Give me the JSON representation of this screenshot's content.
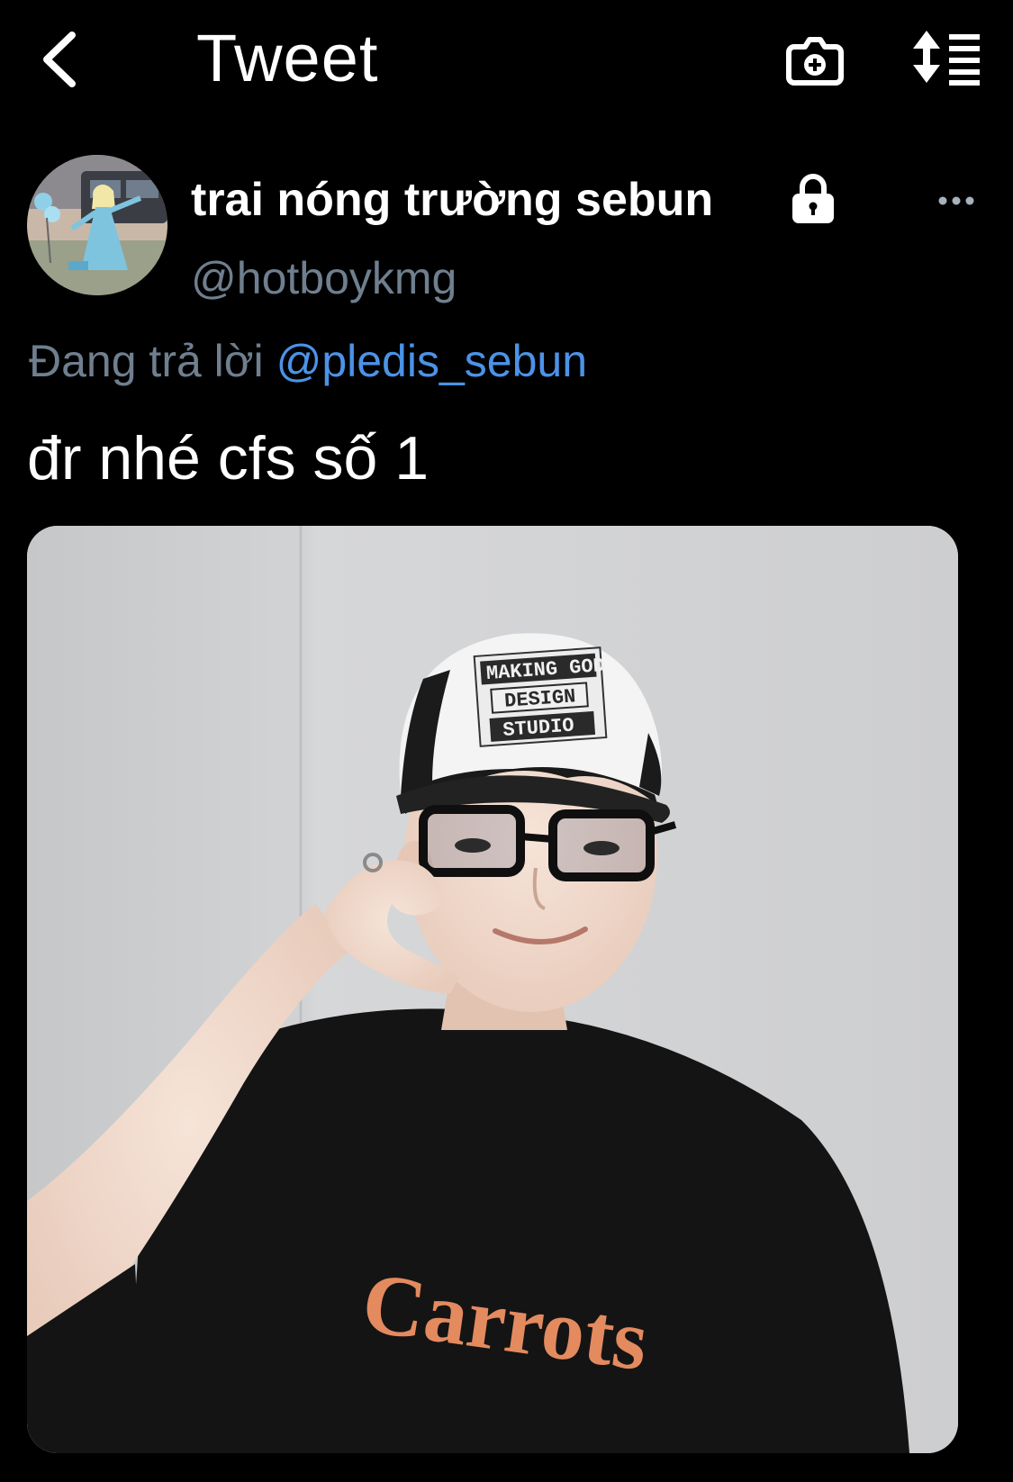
{
  "nav": {
    "back_icon": "chevron-left-icon",
    "title": "Tweet",
    "camera_icon": "camera-add-icon",
    "sort_icon": "sort-list-icon"
  },
  "author": {
    "display_name": "trai nóng trường sebun",
    "handle": "@hotboykmg",
    "protected_icon": "lock-icon",
    "more_icon": "more-horizontal-icon"
  },
  "reply": {
    "prefix": "Đang trả lời",
    "mention": "@pledis_sebun"
  },
  "tweet": {
    "text": "đr nhé cfs số 1"
  },
  "media": {
    "cap_text_lines": [
      "MAKING GOD",
      "DESIGN",
      "STUDIO"
    ],
    "shirt_text": "Carrots"
  },
  "colors": {
    "background": "#000000",
    "primary_text": "#ffffff",
    "secondary_text": "#6f7f8f",
    "link": "#4b93e8"
  }
}
